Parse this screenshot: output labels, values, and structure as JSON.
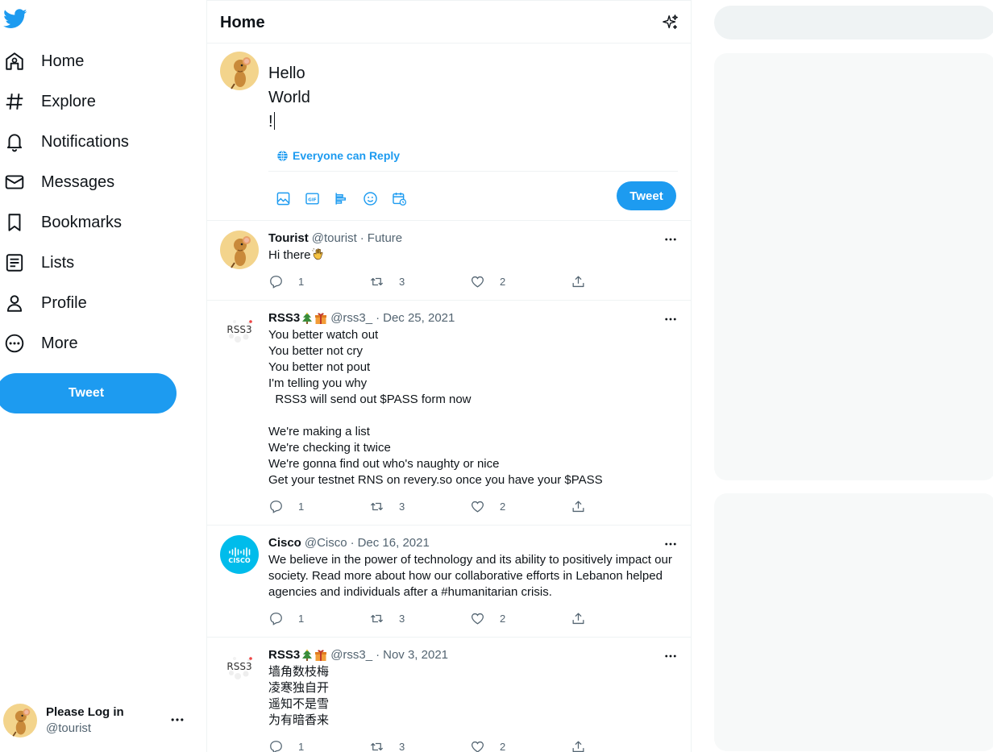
{
  "sidebar": {
    "logo": "twitter-bird-icon",
    "items": [
      {
        "label": "Home",
        "icon": "home-icon"
      },
      {
        "label": "Explore",
        "icon": "hashtag-icon"
      },
      {
        "label": "Notifications",
        "icon": "bell-icon"
      },
      {
        "label": "Messages",
        "icon": "envelope-icon"
      },
      {
        "label": "Bookmarks",
        "icon": "bookmark-icon"
      },
      {
        "label": "Lists",
        "icon": "list-icon"
      },
      {
        "label": "Profile",
        "icon": "person-icon"
      },
      {
        "label": "More",
        "icon": "more-circle-icon"
      }
    ],
    "tweet_button": "Tweet",
    "account": {
      "name": "Please Log in",
      "handle": "@tourist"
    }
  },
  "header": {
    "title": "Home"
  },
  "composer": {
    "lines": [
      "Hello",
      "World",
      "!"
    ],
    "reply_setting": "Everyone can Reply",
    "tools": [
      "image-icon",
      "gif-icon",
      "poll-icon",
      "emoji-icon",
      "schedule-icon"
    ],
    "tweet_button": "Tweet"
  },
  "tweets": [
    {
      "name": "Tourist",
      "handle": "@tourist",
      "time": "Future",
      "text": "Hi there",
      "emoji": "waving-hand",
      "replies": "1",
      "retweets": "3",
      "likes": "2"
    },
    {
      "name": "RSS3",
      "name_emojis": [
        "christmas-tree",
        "gift"
      ],
      "handle": "@rss3_",
      "time": "Dec 25, 2021",
      "text": "You better watch out\nYou better not cry\nYou better not pout\nI'm telling you why\n  RSS3 will send out $PASS form now\n\nWe're making a list\nWe're checking it twice\nWe're gonna find out who's naughty or nice\nGet your testnet RNS on revery.so once you have your $PASS",
      "replies": "1",
      "retweets": "3",
      "likes": "2"
    },
    {
      "name": "Cisco",
      "handle": "@Cisco",
      "time": "Dec 16, 2021",
      "text": "We believe in the power of technology and its ability to positively impact our\nsociety. Read more about how our collaborative efforts in Lebanon helped\nagencies and individuals after a #humanitarian crisis.",
      "replies": "1",
      "retweets": "3",
      "likes": "2",
      "avatar_text": "CISCO"
    },
    {
      "name": "RSS3",
      "name_emojis": [
        "christmas-tree",
        "gift"
      ],
      "handle": "@rss3_",
      "time": "Nov 3, 2021",
      "text": "墙角数枝梅\n凌寒独自开\n遥知不是雪\n为有暗香来",
      "replies": "1",
      "retweets": "3",
      "likes": "2"
    }
  ],
  "rss3_avatar_text": "RSS3",
  "colors": {
    "accent": "#1d9bf0",
    "muted": "#536471",
    "border": "#eff3f4",
    "panel": "#f7f9f9"
  }
}
